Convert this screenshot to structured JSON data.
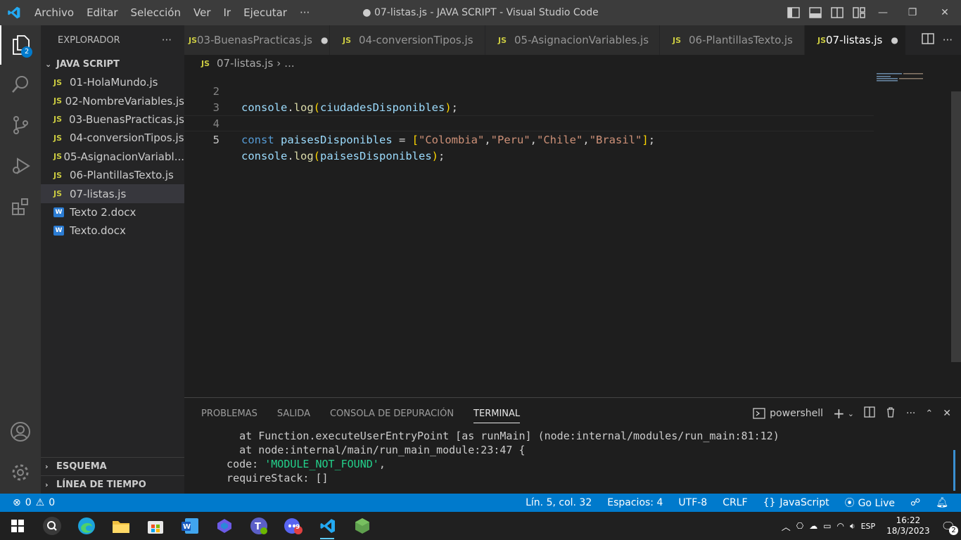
{
  "window": {
    "title": "● 07-listas.js - JAVA SCRIPT - Visual Studio Code",
    "menu": [
      "Archivo",
      "Editar",
      "Selección",
      "Ver",
      "Ir",
      "Ejecutar",
      "···"
    ]
  },
  "activity_bar": {
    "explorer_badge": "2",
    "items": [
      "files-icon",
      "search-icon",
      "source-control-icon",
      "run-debug-icon",
      "extensions-icon",
      "account-icon",
      "settings-gear-icon"
    ]
  },
  "sidebar": {
    "header": "EXPLORADOR",
    "more": "···",
    "folder": "JAVA SCRIPT",
    "files": [
      {
        "icon": "JS",
        "name": "01-HolaMundo.js"
      },
      {
        "icon": "JS",
        "name": "02-NombreVariables.js"
      },
      {
        "icon": "JS",
        "name": "03-BuenasPracticas.js"
      },
      {
        "icon": "JS",
        "name": "04-conversionTipos.js"
      },
      {
        "icon": "JS",
        "name": "05-AsignacionVariabl..."
      },
      {
        "icon": "JS",
        "name": "06-PlantillasTexto.js"
      },
      {
        "icon": "JS",
        "name": "07-listas.js"
      },
      {
        "icon": "W",
        "name": "Texto 2.docx"
      },
      {
        "icon": "W",
        "name": "Texto.docx"
      }
    ],
    "outline": "ESQUEMA",
    "timeline": "LÍNEA DE TIEMPO"
  },
  "tabs": [
    {
      "icon": "JS",
      "label": "03-BuenasPracticas.js",
      "dirty": "●"
    },
    {
      "icon": "JS",
      "label": "04-conversionTipos.js",
      "dirty": ""
    },
    {
      "icon": "JS",
      "label": "05-AsignacionVariables.js",
      "dirty": ""
    },
    {
      "icon": "JS",
      "label": "06-PlantillasTexto.js",
      "dirty": ""
    },
    {
      "icon": "JS",
      "label": "07-listas.js",
      "dirty": "●"
    }
  ],
  "breadcrumb": {
    "icon": "JS",
    "file": "07-listas.js",
    "sep": "›",
    "rest": "..."
  },
  "editor": {
    "line_numbers": [
      "2",
      "3",
      "4",
      "5"
    ],
    "line2": {
      "obj": "console",
      "dot": ".",
      "fn": "log",
      "open": "(",
      "arg": "ciudadesDisponibles",
      "close": ")",
      "end": ";"
    },
    "line4": {
      "kw": "const",
      "name": "paisesDisponibles",
      "eq": " = ",
      "open": "[",
      "items": [
        "\"Colombia\"",
        "\"Peru\"",
        "\"Chile\"",
        "\"Brasil\""
      ],
      "comma": ",",
      "close": "]",
      "end": ";"
    },
    "line5": {
      "obj": "console",
      "dot": ".",
      "fn": "log",
      "open": "(",
      "arg": "paisesDisponibles",
      "close": ")",
      "end": ";"
    }
  },
  "panel": {
    "tabs": [
      "PROBLEMAS",
      "SALIDA",
      "CONSOLA DE DEPURACIÓN",
      "TERMINAL"
    ],
    "shell": "powershell",
    "terminal": [
      "    at Function.executeUserEntryPoint [as runMain] (node:internal/modules/run_main:81:12)",
      "    at node:internal/main/run_main_module:23:47 {",
      "  code: ",
      "  requireStack: []"
    ],
    "terminal_code_value": "'MODULE_NOT_FOUND'",
    "terminal_code_tail": ","
  },
  "statusbar": {
    "errors": "0",
    "warnings": "0",
    "position": "Lín. 5, col. 32",
    "spaces": "Espacios: 4",
    "encoding": "UTF-8",
    "eol": "CRLF",
    "language": "JavaScript",
    "golive": "Go Live"
  },
  "taskbar": {
    "apps": [
      "windows-start-icon",
      "search-icon",
      "edge-icon",
      "file-explorer-icon",
      "store-icon",
      "word-icon",
      "copilot-icon",
      "teams-icon",
      "discord-icon",
      "vscode-icon",
      "nodejs-icon"
    ],
    "discord_badge": "9",
    "lang": "ESP",
    "time": "16:22",
    "date": "18/3/2023",
    "notif_count": "2"
  },
  "colors": {
    "statusbar": "#007acc",
    "keyword": "#569cd6",
    "variable": "#9cdcfe",
    "string": "#ce9178",
    "function": "#dcdcaa",
    "bracket": "#ffd700",
    "js_icon": "#cbcb41"
  }
}
